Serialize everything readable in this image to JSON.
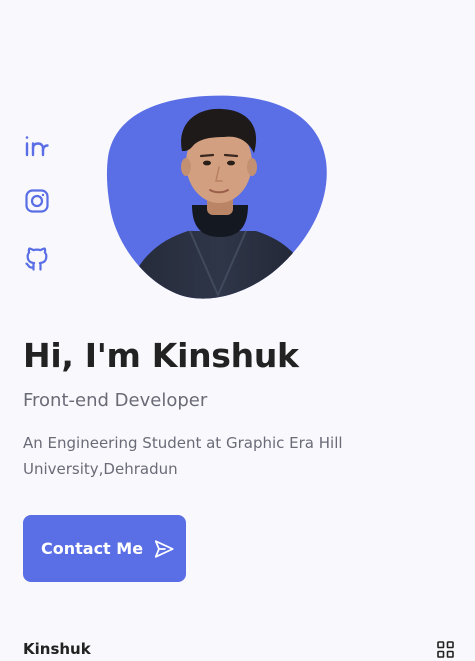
{
  "hero": {
    "title": "Hi, I'm Kinshuk",
    "subtitle": "Front-end Developer",
    "description": "An Engineering Student at Graphic Era Hill University,Dehradun",
    "contact_label": "Contact Me"
  },
  "social": {
    "items": [
      {
        "icon": "linkedin-icon"
      },
      {
        "icon": "instagram-icon"
      },
      {
        "icon": "github-icon"
      }
    ]
  },
  "footer": {
    "brand": "Kinshuk",
    "menu_icon": "grid-menu-icon"
  },
  "colors": {
    "accent": "#5a6ee6",
    "background": "#f9f8fc",
    "title": "#222222",
    "muted": "#6b6b78"
  }
}
